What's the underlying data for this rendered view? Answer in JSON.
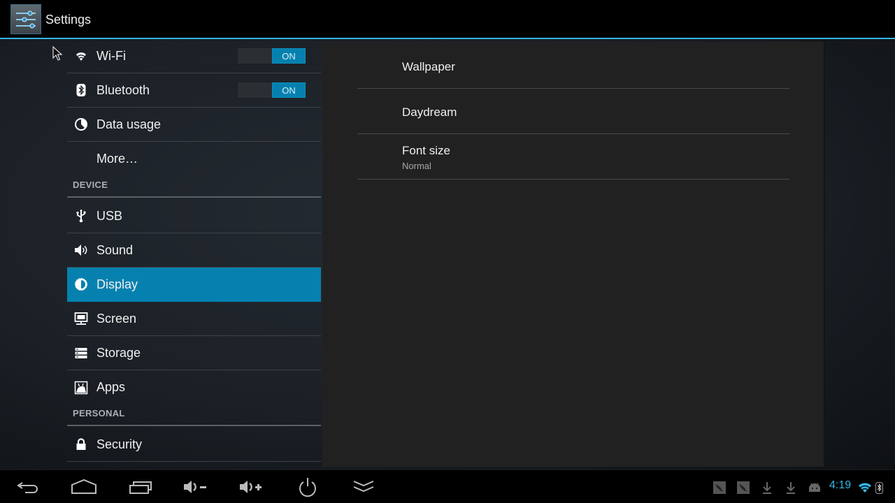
{
  "app": {
    "title": "Settings",
    "icon": "settings-sliders-icon",
    "accent_color": "#33b5e5",
    "selected_color": "#0681af"
  },
  "headers": {
    "items": [
      {
        "type": "item",
        "id": "wifi",
        "label": "Wi-Fi",
        "icon": "wifi-icon",
        "toggle": "ON"
      },
      {
        "type": "item",
        "id": "bluetooth",
        "label": "Bluetooth",
        "icon": "bluetooth-icon",
        "toggle": "ON"
      },
      {
        "type": "item",
        "id": "data-usage",
        "label": "Data usage",
        "icon": "data-usage-icon"
      },
      {
        "type": "item",
        "id": "more",
        "label": "More…"
      },
      {
        "type": "category",
        "label": "DEVICE"
      },
      {
        "type": "item",
        "id": "usb",
        "label": "USB",
        "icon": "usb-icon"
      },
      {
        "type": "item",
        "id": "sound",
        "label": "Sound",
        "icon": "sound-icon"
      },
      {
        "type": "item",
        "id": "display",
        "label": "Display",
        "icon": "display-brightness-icon",
        "selected": true
      },
      {
        "type": "item",
        "id": "screen",
        "label": "Screen",
        "icon": "screen-monitor-icon"
      },
      {
        "type": "item",
        "id": "storage",
        "label": "Storage",
        "icon": "storage-icon"
      },
      {
        "type": "item",
        "id": "apps",
        "label": "Apps",
        "icon": "apps-icon"
      },
      {
        "type": "category",
        "label": "PERSONAL"
      },
      {
        "type": "item",
        "id": "security",
        "label": "Security",
        "icon": "lock-icon"
      }
    ]
  },
  "detail": {
    "preferences": [
      {
        "title": "Wallpaper"
      },
      {
        "title": "Daydream"
      },
      {
        "title": "Font size",
        "summary": "Normal"
      }
    ]
  },
  "navbar": {
    "buttons": [
      "back",
      "home",
      "recent-apps",
      "volume-down",
      "volume-up",
      "power",
      "hide-bar"
    ],
    "status_icons": [
      "screenshot-notification",
      "screenshot-notification",
      "download",
      "download",
      "android-debug"
    ],
    "clock": "4:19",
    "indicators": [
      "wifi-signal",
      "bluetooth"
    ]
  }
}
